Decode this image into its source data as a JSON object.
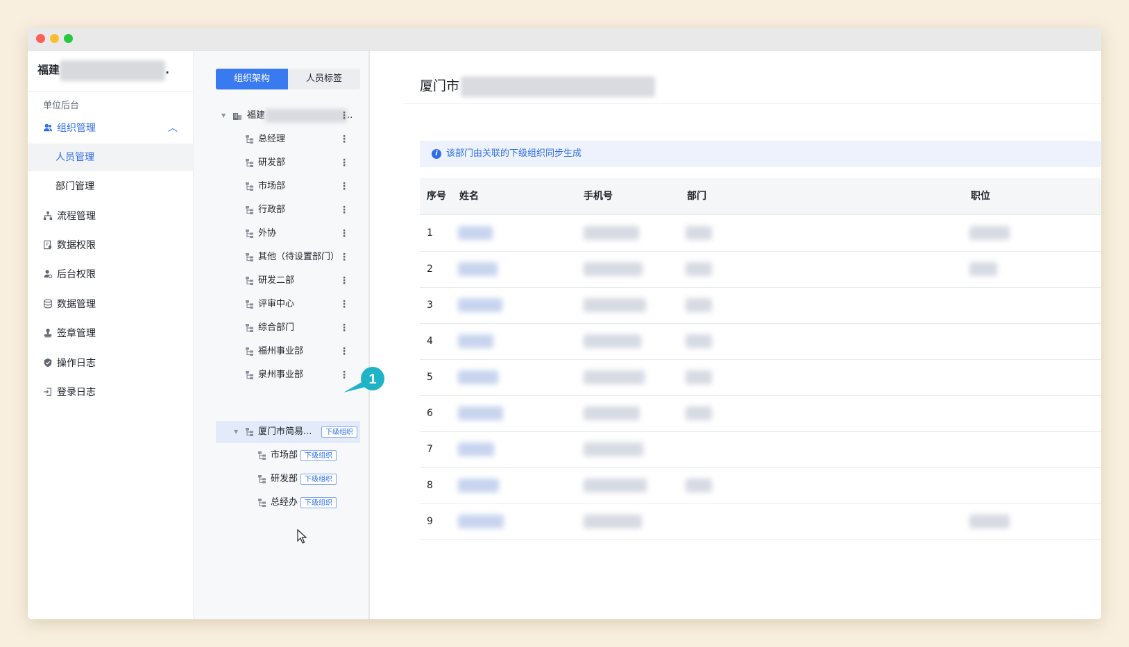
{
  "window": {
    "controls": [
      "close",
      "minimize",
      "maximize"
    ]
  },
  "sidebar": {
    "org_name_visible": "福建",
    "org_name_suffix": ".",
    "section_label": "单位后台",
    "groups": [
      {
        "label": "组织管理",
        "icon": "users-icon",
        "expanded": true,
        "children": [
          {
            "label": "人员管理",
            "selected": true
          },
          {
            "label": "部门管理",
            "selected": false
          }
        ]
      },
      {
        "label": "流程管理",
        "icon": "flow-icon"
      },
      {
        "label": "数据权限",
        "icon": "data-permission-icon"
      },
      {
        "label": "后台权限",
        "icon": "admin-permission-icon"
      },
      {
        "label": "数据管理",
        "icon": "database-icon"
      },
      {
        "label": "签章管理",
        "icon": "stamp-icon"
      },
      {
        "label": "操作日志",
        "icon": "shield-icon"
      },
      {
        "label": "登录日志",
        "icon": "login-icon"
      }
    ]
  },
  "tree": {
    "tabs": [
      {
        "label": "组织架构",
        "active": true
      },
      {
        "label": "人员标签",
        "active": false
      }
    ],
    "root": {
      "label": "福建",
      "suffix": ".."
    },
    "nodes": [
      "总经理",
      "研发部",
      "市场部",
      "行政部",
      "外协",
      "其他（待设置部门）",
      "研发二部",
      "评审中心",
      "综合部门",
      "福州事业部",
      "泉州事业部"
    ],
    "selected_node": {
      "label": "厦门市简易...",
      "tag": "下级组织"
    },
    "sub_nodes": [
      {
        "label": "市场部",
        "tag": "下级组织"
      },
      {
        "label": "研发部",
        "tag": "下级组织"
      },
      {
        "label": "总经办",
        "tag": "下级组织"
      }
    ],
    "callout_number": "1"
  },
  "content": {
    "title_visible": "厦门市",
    "notice": "该部门由关联的下级组织同步生成",
    "columns": {
      "index": "序号",
      "name": "姓名",
      "phone": "手机号",
      "dept": "部门",
      "position": "职位"
    },
    "rows": [
      {
        "index": "1",
        "dept": true,
        "position": true
      },
      {
        "index": "2",
        "dept": true,
        "position": true
      },
      {
        "index": "3",
        "dept": true,
        "position": false
      },
      {
        "index": "4",
        "dept": true,
        "position": false
      },
      {
        "index": "5",
        "dept": true,
        "position": false
      },
      {
        "index": "6",
        "dept": true,
        "position": false
      },
      {
        "index": "7",
        "dept": false,
        "position": false
      },
      {
        "index": "8",
        "dept": true,
        "position": false
      },
      {
        "index": "9",
        "dept": false,
        "position": true
      }
    ]
  },
  "colors": {
    "accent": "#2f6ee8",
    "callout": "#1fb3c8",
    "background": "#f9efdf"
  }
}
